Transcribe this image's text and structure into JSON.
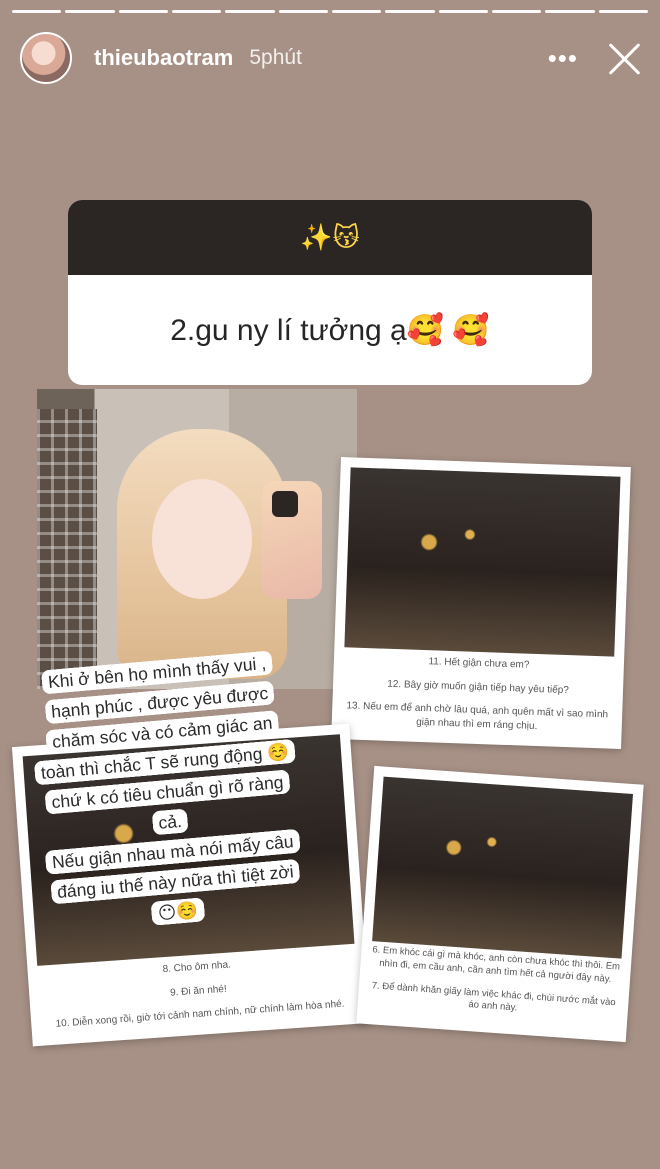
{
  "story": {
    "progress_segments": 12,
    "active_segments": 12,
    "username": "thieubaotram",
    "time": "5phút",
    "more_label": "•••"
  },
  "question": {
    "header_emoji": "✨😽",
    "text": "2.gu ny lí tưởng ạ🥰 🥰"
  },
  "caption": {
    "text": "Khi ở bên họ mình thấy vui , hạnh phúc , được yêu được chăm sóc và có cảm giác an toàn thì chắc T sẽ rung động ☺️ chứ k có tiêu chuẩn gì rõ ràng cả.\nNếu giận nhau mà nói mấy câu đáng iu thế này nữa thì tiệt zời 😶☺️"
  },
  "cards": [
    {
      "lines": [
        "11. Hết giận chưa em?",
        "12. Bây giờ muốn giận tiếp hay yêu tiếp?",
        "13. Nếu em để anh chờ lâu quá, anh quên mất vì sao mình giận nhau thì em ráng chịu."
      ]
    },
    {
      "lines": [
        "8. Cho ôm nha.",
        "9. Đi ăn nhé!",
        "10. Diễn xong rồi, giờ tới cảnh nam chính, nữ chính làm hòa nhé."
      ]
    },
    {
      "lines": [
        "6. Em khóc cái gì mà khóc, anh còn chưa khóc thì thôi. Em nhìn đi, em cầu anh, cần anh tìm hết cả người đây này.",
        "7. Để dành khăn giấy làm việc khác đi, chùi nước mắt vào áo anh này."
      ]
    }
  ]
}
